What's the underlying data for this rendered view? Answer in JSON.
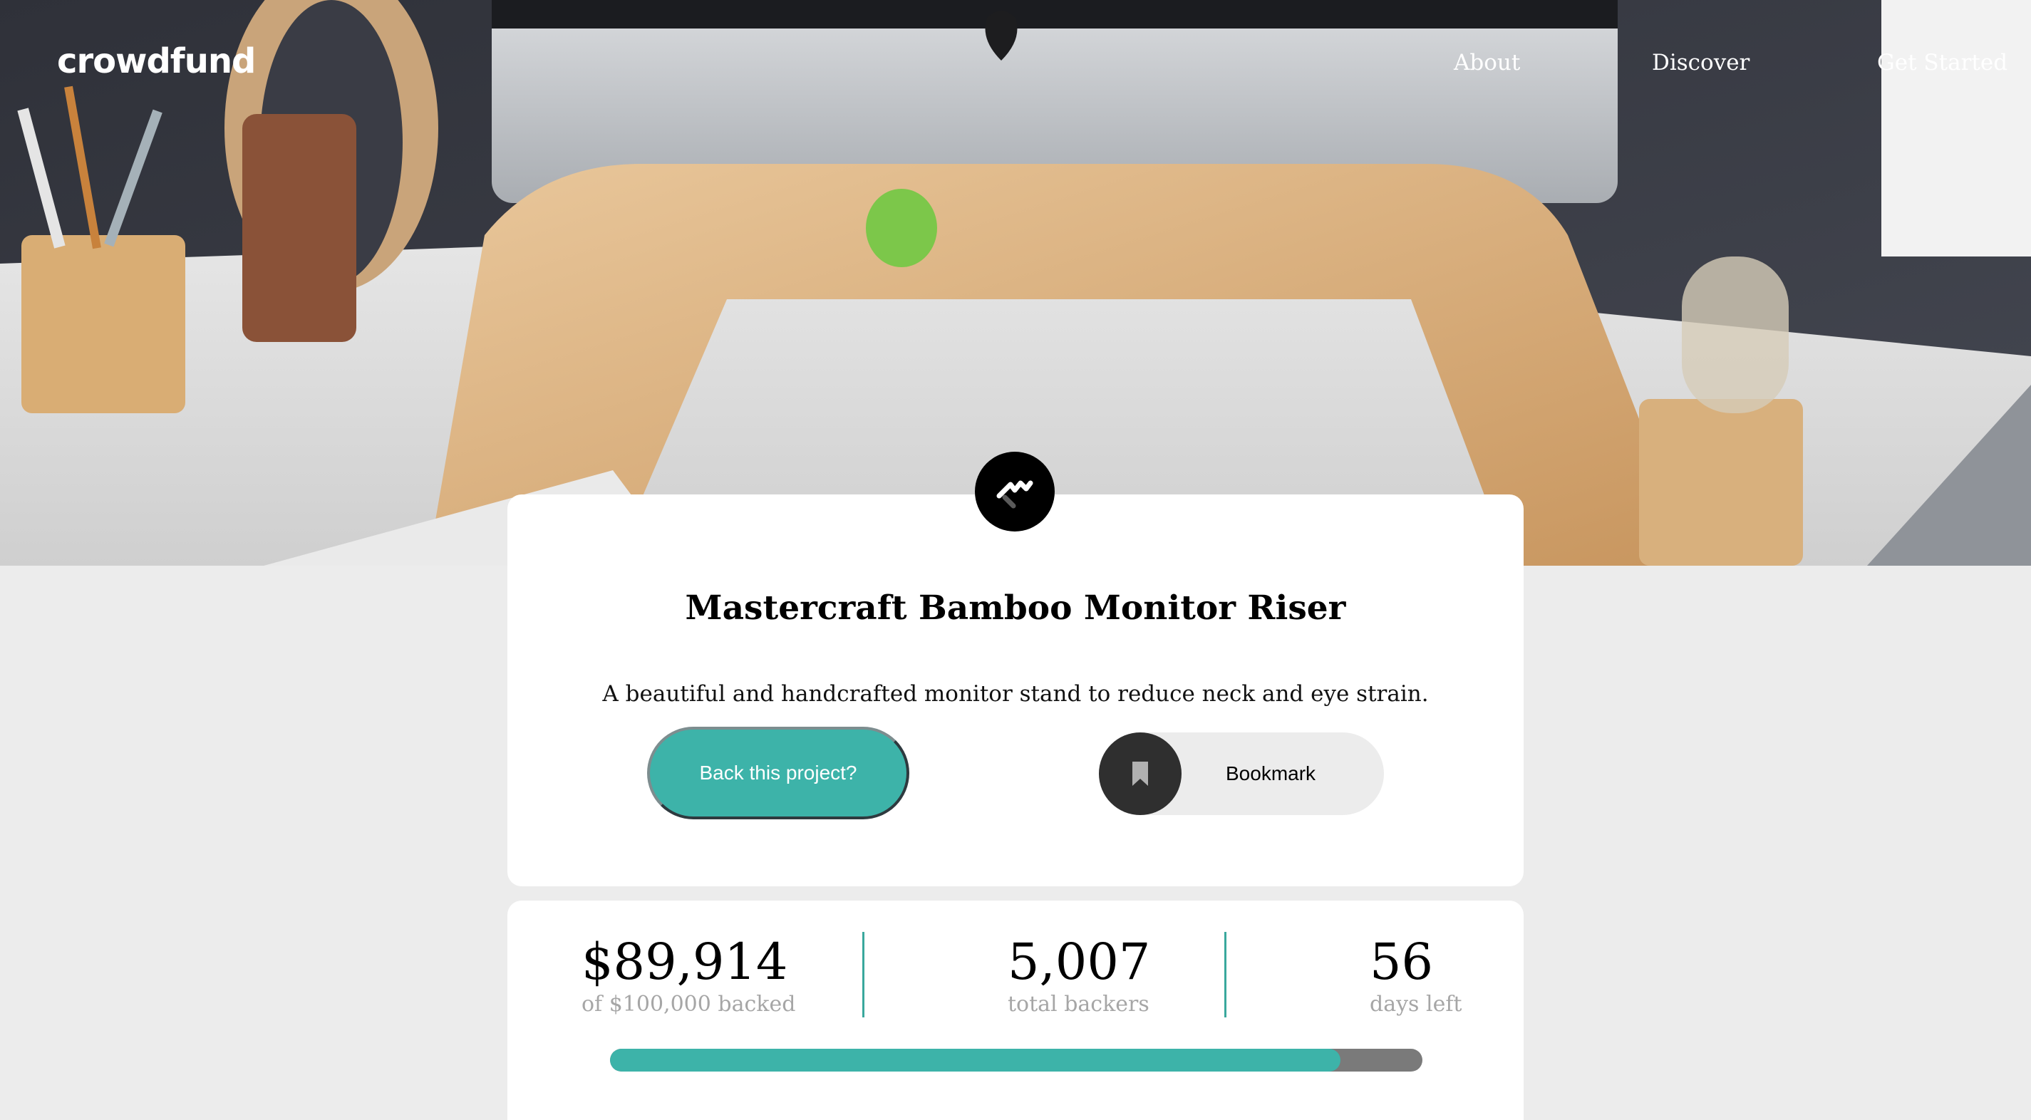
{
  "brand": {
    "name": "crowdfund"
  },
  "nav": {
    "items": [
      {
        "label": "About"
      },
      {
        "label": "Discover"
      },
      {
        "label": "Get Started"
      }
    ]
  },
  "project": {
    "logo_icon": "mastercraft-logo-icon",
    "title": "Mastercraft Bamboo Monitor Riser",
    "description": "A beautiful and handcrafted monitor stand to reduce neck and eye strain.",
    "back_button_label": "Back this project?",
    "bookmark_label": "Bookmark",
    "bookmark_icon": "bookmark-icon"
  },
  "stats": {
    "backed_amount": "$89,914",
    "backed_label": "of $100,000 backed",
    "backers_count": "5,007",
    "backers_label": "total backers",
    "days_count": "56",
    "days_label": "days left",
    "progress_fraction": 0.899
  },
  "colors": {
    "accent": "#3db3a9",
    "divider": "#3aa89d",
    "progress_track": "#7a7a7a",
    "page_background": "#ececec"
  }
}
